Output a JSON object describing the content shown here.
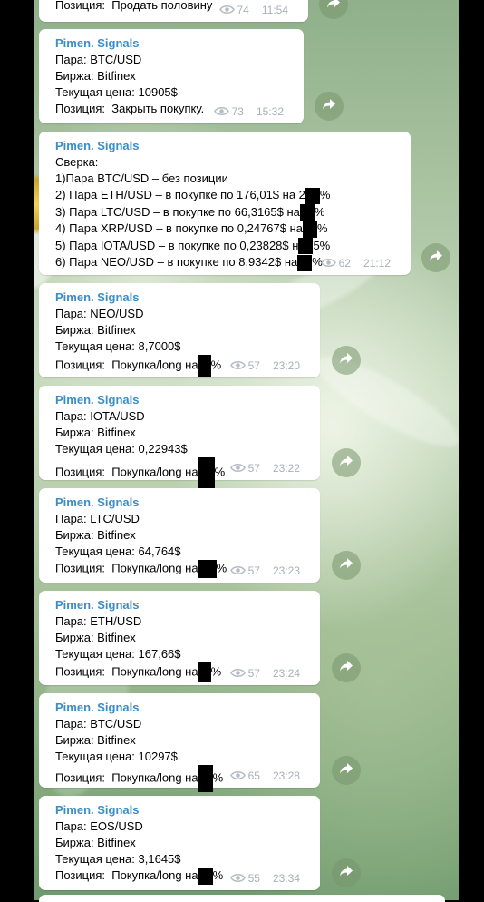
{
  "messages": [
    {
      "sender": "",
      "lines": [
        "Позиция:  Продать половину"
      ],
      "views": "74",
      "time": "11:54"
    },
    {
      "sender": "Pimen. Signals",
      "lines": [
        "Пара: BTC/USD",
        "Биржа: Bitfinex",
        "Текущая цена: 10905$",
        "Позиция:  Закрыть покупку."
      ],
      "views": "73",
      "time": "15:32"
    },
    {
      "sender": "Pimen. Signals",
      "lines": [
        "Сверка:",
        "1)Пара BTC/USD – без позиции",
        "2) Пара ETH/USD – в покупке по 176,01$ на 2",
        "3) Пара LTC/USD – в покупке по 66,3165$ на",
        "4) Пара XRP/USD – в покупке по 0,24767$ на",
        "5) Пара IOTA/USD – в покупке по 0,23828$ н",
        "6) Пара NEO/USD – в покупке по 8,9342$ на"
      ],
      "line_tails": [
        "",
        "",
        "%",
        "%",
        "%",
        "5%",
        "%"
      ],
      "views": "62",
      "time": "21:12"
    },
    {
      "sender": "Pimen. Signals",
      "lines": [
        "Пара: NEO/USD",
        "Биржа: Bitfinex",
        "Текущая цена: 8,7000$",
        "Позиция:  Покупка/long на"
      ],
      "tail": "%",
      "views": "57",
      "time": "23:20"
    },
    {
      "sender": "Pimen. Signals",
      "lines": [
        "Пара: IOTA/USD",
        "Биржа: Bitfinex",
        "Текущая цена: 0,22943$",
        "Позиция:  Покупка/long на"
      ],
      "tail": "%",
      "views": "57",
      "time": "23:22"
    },
    {
      "sender": "Pimen. Signals",
      "lines": [
        "Пара: LTC/USD",
        "Биржа: Bitfinex",
        "Текущая цена: 64,764$",
        "Позиция:  Покупка/long на"
      ],
      "tail": "%",
      "views": "57",
      "time": "23:23"
    },
    {
      "sender": "Pimen. Signals",
      "lines": [
        "Пара: ETH/USD",
        "Биржа: Bitfinex",
        "Текущая цена: 167,66$",
        "Позиция:  Покупка/long на"
      ],
      "tail": "%",
      "views": "57",
      "time": "23:24"
    },
    {
      "sender": "Pimen. Signals",
      "lines": [
        "Пара: BTC/USD",
        "Биржа: Bitfinex",
        "Текущая цена: 10297$",
        "Позиция:  Покупка/long на"
      ],
      "tail": "%",
      "views": "65",
      "time": "23:28"
    },
    {
      "sender": "Pimen. Signals",
      "lines": [
        "Пара: EOS/USD",
        "Биржа: Bitfinex",
        "Текущая цена: 3,1645$",
        "Позиция:  Покупка/long на"
      ],
      "tail": "%",
      "views": "55",
      "time": "23:34"
    }
  ],
  "icons": {
    "views": "eye-icon",
    "share": "share-arrow-icon"
  },
  "colors": {
    "sender": "#3a8ec8",
    "meta": "#a9b0b8",
    "bubble": "#ffffff"
  }
}
